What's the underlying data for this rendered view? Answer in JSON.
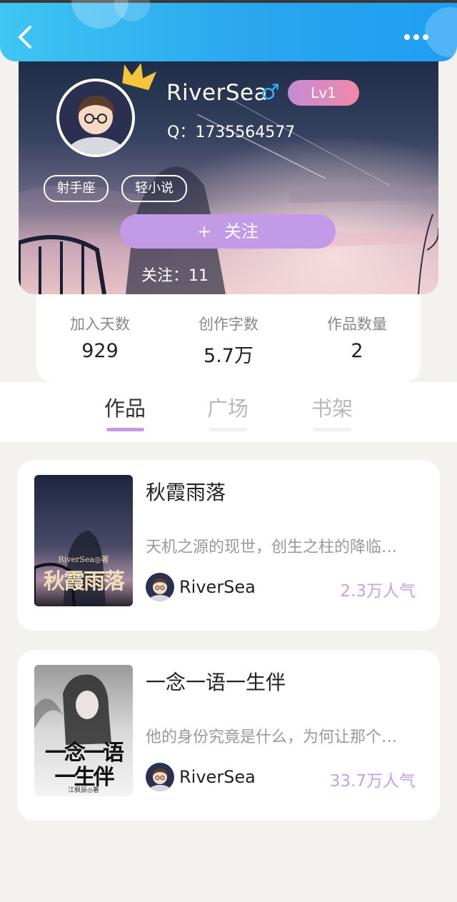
{
  "header": {
    "back_icon": "chevron-left-icon",
    "more_icon": "more-horizontal-icon"
  },
  "profile": {
    "username": "RiverSea",
    "gender_symbol": "♂",
    "level": "Lv1",
    "qq": "Q：1735564577",
    "tags": [
      "射手座",
      "轻小说"
    ],
    "follow_button": {
      "plus": "+",
      "label": "关注"
    },
    "following_label": "关注：11",
    "colors": {
      "accent": "#c39ae6",
      "header": "#2aa6ef",
      "gender": "#2fb1ff"
    }
  },
  "stats": [
    {
      "label": "加入天数",
      "value": "929"
    },
    {
      "label": "创作字数",
      "value": "5.7万"
    },
    {
      "label": "作品数量",
      "value": "2"
    }
  ],
  "tabs": [
    {
      "label": "作品",
      "active": true
    },
    {
      "label": "广场",
      "active": false
    },
    {
      "label": "书架",
      "active": false
    }
  ],
  "books": [
    {
      "title": "秋霞雨落",
      "description": "天机之源的现世，创生之柱的降临…",
      "author": "RiverSea",
      "popularity": "2.3万人气",
      "cover_author_line": "RiverSea◎著",
      "cover_title": "秋霞雨落"
    },
    {
      "title": "一念一语一生伴",
      "description": "他的身份究竟是什么，为何让那个…",
      "author": "RiverSea",
      "popularity": "33.7万人气",
      "cover_title_line1": "一念一语",
      "cover_title_line2": "一生伴",
      "cover_author_line": "江枫辰◎著"
    }
  ]
}
